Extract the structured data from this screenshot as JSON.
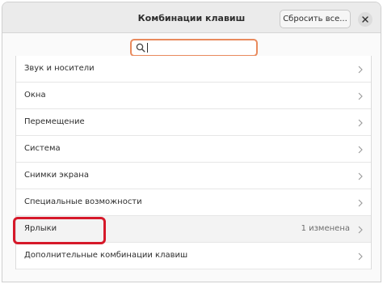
{
  "window": {
    "title": "Комбинации клавиш",
    "reset_label": "Сбросить все...",
    "close_icon": "close-icon"
  },
  "search": {
    "value": "",
    "placeholder": "",
    "icon": "search-icon",
    "border_color": "#e98a5d"
  },
  "list": {
    "items": [
      {
        "label": "Звук и носители",
        "status": ""
      },
      {
        "label": "Окна",
        "status": ""
      },
      {
        "label": "Перемещение",
        "status": ""
      },
      {
        "label": "Система",
        "status": ""
      },
      {
        "label": "Снимки экрана",
        "status": ""
      },
      {
        "label": "Специальные возможности",
        "status": ""
      },
      {
        "label": "Ярлыки",
        "status": "1 изменена"
      },
      {
        "label": "Дополнительные комбинации клавиш",
        "status": ""
      }
    ],
    "selected_index": 6
  },
  "annotation": {
    "highlight_color": "#d6192a"
  }
}
